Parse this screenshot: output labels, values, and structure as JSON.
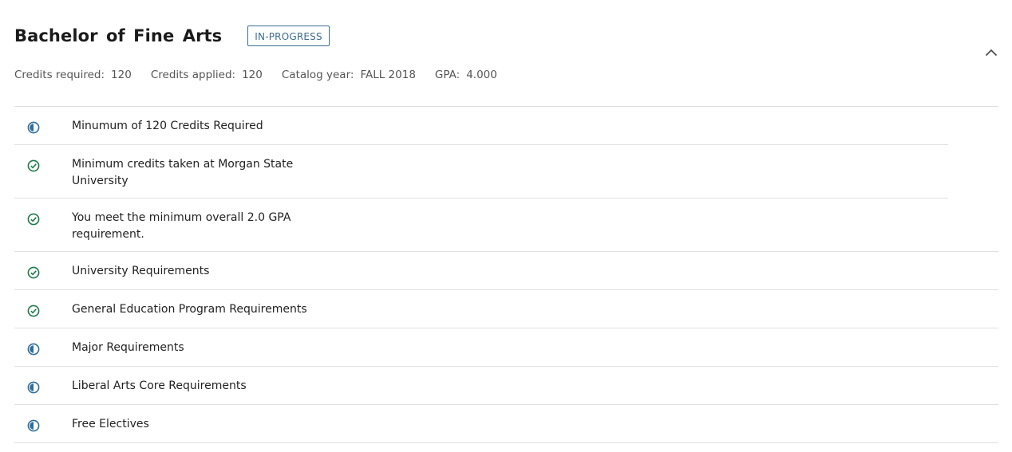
{
  "degree": {
    "title": "Bachelor of Fine Arts",
    "status": "IN-PROGRESS"
  },
  "summary": {
    "credits_required_label": "Credits required:",
    "credits_required_value": "120",
    "credits_applied_label": "Credits applied:",
    "credits_applied_value": "120",
    "catalog_year_label": "Catalog year:",
    "catalog_year_value": "FALL 2018",
    "gpa_label": "GPA:",
    "gpa_value": "4.000"
  },
  "colors": {
    "complete": "#1d7a4a",
    "in_progress": "#2f6e9b",
    "badge": "#3c6d8e"
  },
  "requirements": [
    {
      "label": "Minumum of 120 Credits Required",
      "status": "in-progress",
      "icon": "half-circle-icon"
    },
    {
      "label": "Minimum credits taken at Morgan State University",
      "status": "complete",
      "icon": "check-circle-icon"
    },
    {
      "label": "You meet the minimum overall 2.0 GPA requirement.",
      "status": "complete",
      "icon": "check-circle-icon"
    },
    {
      "label": "University Requirements",
      "status": "complete",
      "icon": "check-circle-icon"
    },
    {
      "label": "General Education Program Requirements",
      "status": "complete",
      "icon": "check-circle-icon"
    },
    {
      "label": "Major Requirements",
      "status": "in-progress",
      "icon": "half-circle-icon"
    },
    {
      "label": "Liberal Arts Core Requirements",
      "status": "in-progress",
      "icon": "half-circle-icon"
    },
    {
      "label": "Free Electives",
      "status": "in-progress",
      "icon": "half-circle-icon"
    }
  ]
}
